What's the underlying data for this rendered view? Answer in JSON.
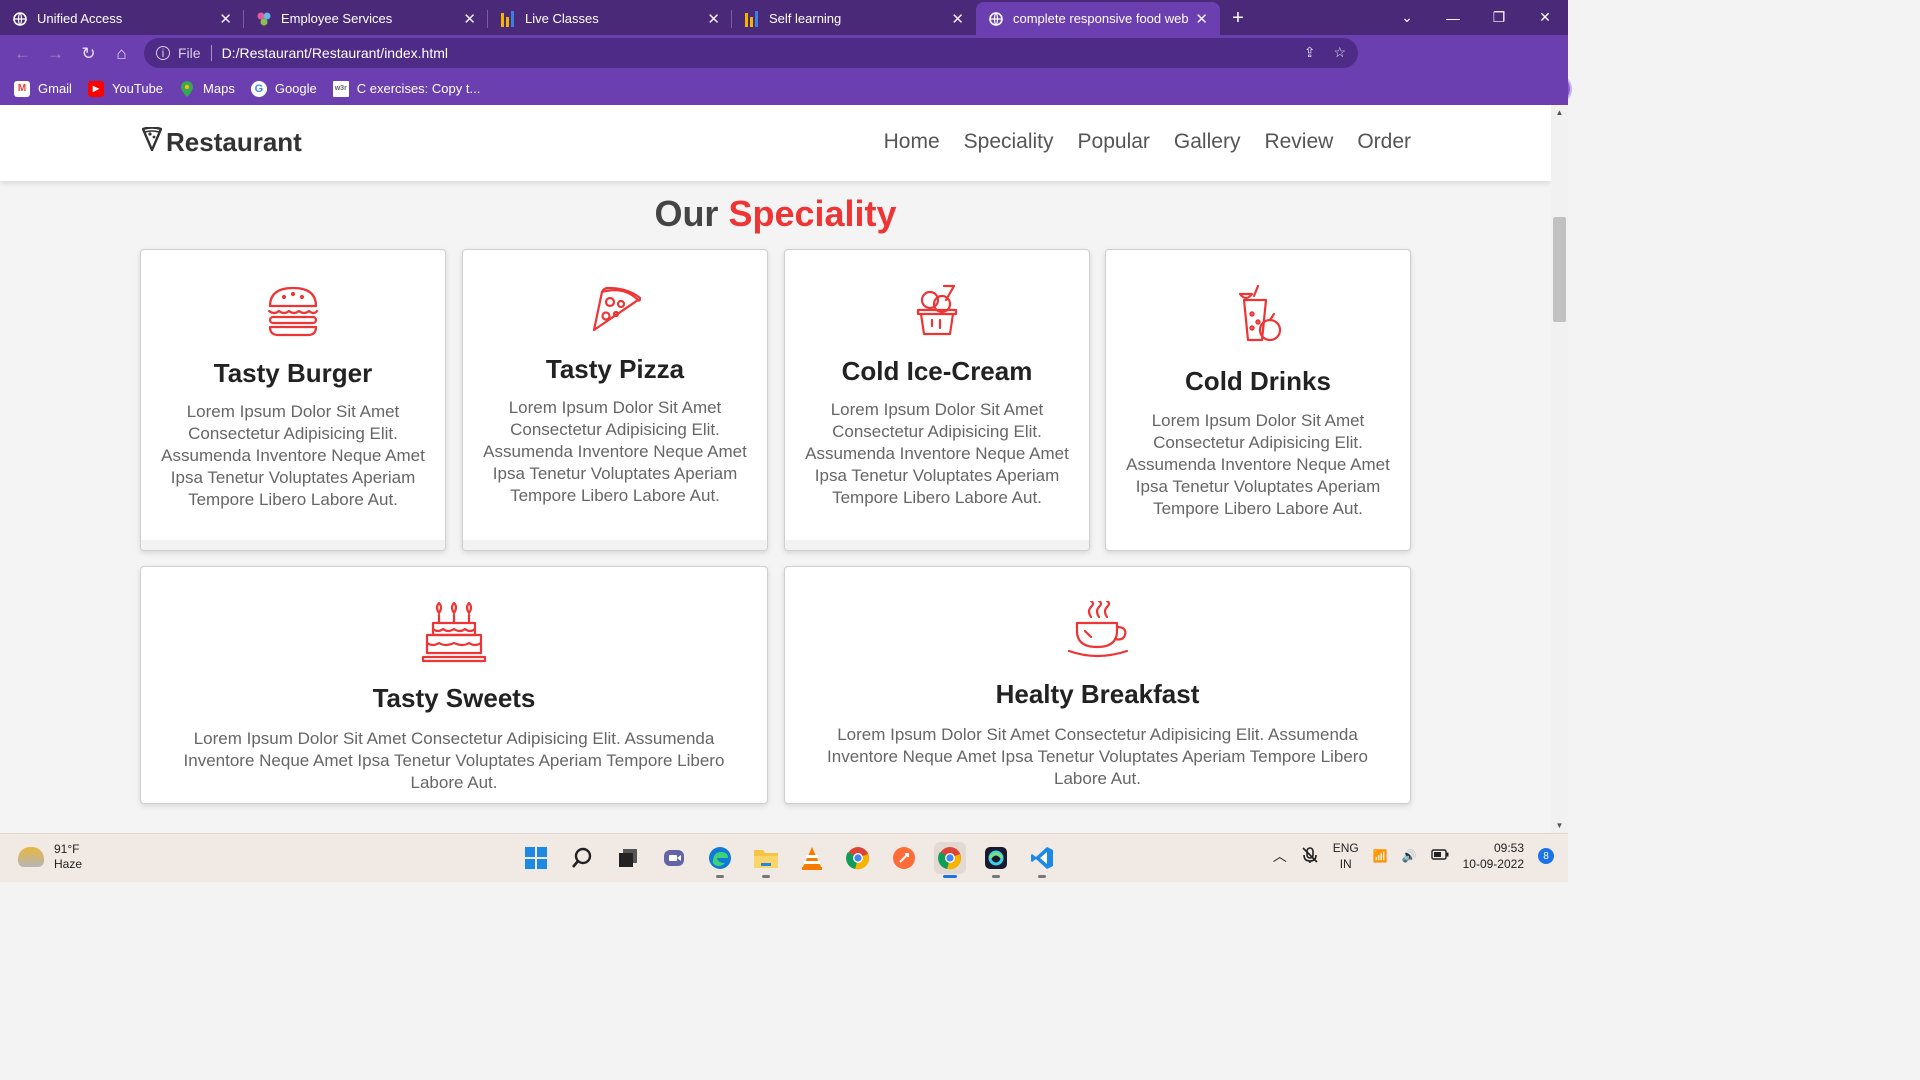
{
  "browser": {
    "tabs": [
      {
        "title": "Unified Access",
        "icon": "globe-icon",
        "active": false
      },
      {
        "title": "Employee Services",
        "icon": "services-icon",
        "active": false
      },
      {
        "title": "Live Classes",
        "icon": "bars-icon",
        "active": false
      },
      {
        "title": "Self learning",
        "icon": "bars-icon",
        "active": false
      },
      {
        "title": "complete responsive food websit",
        "icon": "globe-icon",
        "active": true
      }
    ],
    "address": {
      "scheme_label": "File",
      "url": "D:/Restaurant/Restaurant/index.html"
    },
    "bookmarks": [
      {
        "label": "Gmail",
        "icon": "gmail-icon"
      },
      {
        "label": "YouTube",
        "icon": "youtube-icon"
      },
      {
        "label": "Maps",
        "icon": "maps-icon"
      },
      {
        "label": "Google",
        "icon": "google-icon"
      },
      {
        "label": "C exercises: Copy t...",
        "icon": "w3r-icon"
      }
    ]
  },
  "site": {
    "logo": "Restaurant",
    "nav": [
      "Home",
      "Speciality",
      "Popular",
      "Gallery",
      "Review",
      "Order"
    ],
    "heading": {
      "part1": "Our",
      "part2": "Speciality"
    },
    "cards": [
      {
        "title": "Tasty Burger",
        "icon": "burger-icon",
        "text": "Lorem Ipsum Dolor Sit Amet Consectetur Adipisicing Elit. Assumenda Inventore Neque Amet Ipsa Tenetur Voluptates Aperiam Tempore Libero Labore Aut."
      },
      {
        "title": "Tasty Pizza",
        "icon": "pizza-icon",
        "text": "Lorem Ipsum Dolor Sit Amet Consectetur Adipisicing Elit. Assumenda Inventore Neque Amet Ipsa Tenetur Voluptates Aperiam Tempore Libero Labore Aut."
      },
      {
        "title": "Cold Ice-Cream",
        "icon": "ice-cream-icon",
        "text": "Lorem Ipsum Dolor Sit Amet Consectetur Adipisicing Elit. Assumenda Inventore Neque Amet Ipsa Tenetur Voluptates Aperiam Tempore Libero Labore Aut."
      },
      {
        "title": "Cold Drinks",
        "icon": "drink-icon",
        "text": "Lorem Ipsum Dolor Sit Amet Consectetur Adipisicing Elit. Assumenda Inventore Neque Amet Ipsa Tenetur Voluptates Aperiam Tempore Libero Labore Aut."
      },
      {
        "title": "Tasty Sweets",
        "icon": "cake-icon",
        "text": "Lorem Ipsum Dolor Sit Amet Consectetur Adipisicing Elit. Assumenda Inventore Neque Amet Ipsa Tenetur Voluptates Aperiam Tempore Libero Labore Aut."
      },
      {
        "title": "Healty Breakfast",
        "icon": "coffee-icon",
        "text": "Lorem Ipsum Dolor Sit Amet Consectetur Adipisicing Elit. Assumenda Inventore Neque Amet Ipsa Tenetur Voluptates Aperiam Tempore Libero Labore Aut."
      }
    ],
    "accent_color": "#ee3535"
  },
  "taskbar": {
    "weather": {
      "temp": "91°F",
      "condition": "Haze"
    },
    "lang": {
      "line1": "ENG",
      "line2": "IN"
    },
    "clock": {
      "time": "09:53",
      "date": "10-09-2022"
    },
    "notifications": "8"
  }
}
